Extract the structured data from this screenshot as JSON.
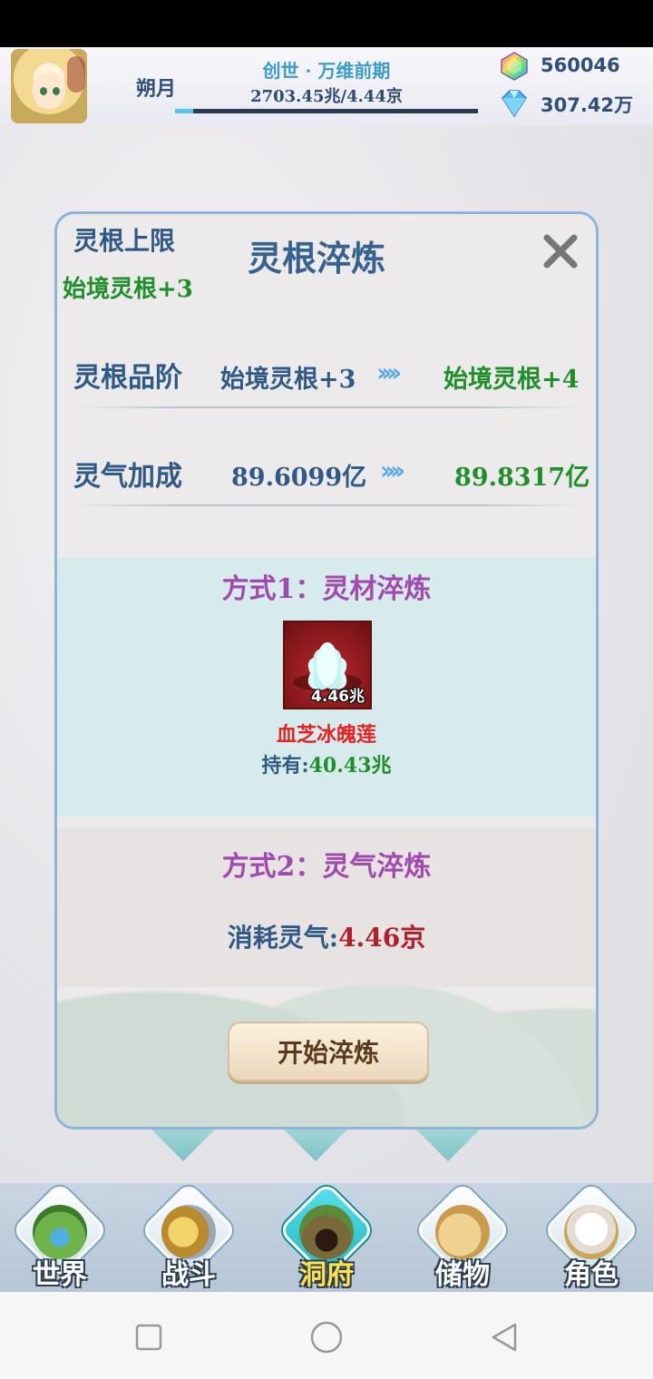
{
  "player": {
    "name": "朔月",
    "realm": "创世 · 万维前期",
    "exp_text": "2703.45兆/4.44京",
    "exp_progress": 0.06
  },
  "currency": {
    "gem": "560046",
    "crystal": "307.42万"
  },
  "dialog": {
    "title": "灵根淬炼",
    "cap_label": "灵根上限",
    "cap_value": "始境灵根+3",
    "rows": [
      {
        "label": "灵根品阶",
        "from": "始境灵根+3",
        "to": "始境灵根+4"
      },
      {
        "label": "灵气加成",
        "from": "89.6099亿",
        "to": "89.8317亿"
      }
    ],
    "arrows": "››››",
    "method1": {
      "title": "方式1：灵材淬炼",
      "item_name": "血芝冰魄莲",
      "item_qty": "4.46兆",
      "own_label": "持有:",
      "own_value": "40.43兆"
    },
    "method2": {
      "title": "方式2：灵气淬炼",
      "cost_label": "消耗灵气:",
      "cost_value": "4.46京"
    },
    "start_button": "开始淬炼"
  },
  "nav": [
    {
      "label": "世界",
      "icon": "world-icon",
      "active": false
    },
    {
      "label": "战斗",
      "icon": "battle-icon",
      "active": false
    },
    {
      "label": "洞府",
      "icon": "cave-icon",
      "active": true
    },
    {
      "label": "储物",
      "icon": "storage-bag-icon",
      "active": false
    },
    {
      "label": "角色",
      "icon": "character-icon",
      "active": false
    }
  ],
  "colors": {
    "accent_blue": "#2f5a88",
    "green": "#1f8f2b",
    "purple": "#a04ab0",
    "red": "#e32222",
    "active_nav": "#ffe34a"
  }
}
